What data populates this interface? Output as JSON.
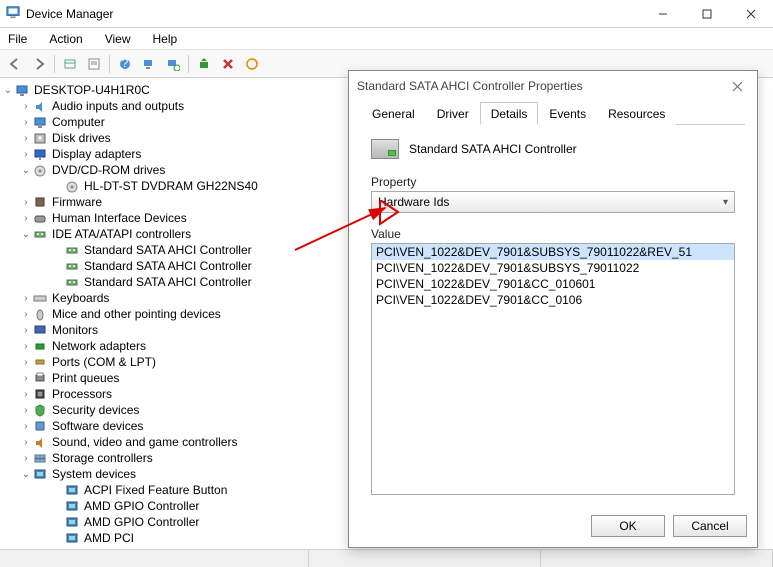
{
  "window": {
    "title": "Device Manager"
  },
  "menus": [
    "File",
    "Action",
    "View",
    "Help"
  ],
  "tree": {
    "root": "DESKTOP-U4H1R0C",
    "items": [
      {
        "label": "Audio inputs and outputs",
        "icon": "audio",
        "expander": "›"
      },
      {
        "label": "Computer",
        "icon": "computer",
        "expander": "›"
      },
      {
        "label": "Disk drives",
        "icon": "disk",
        "expander": "›"
      },
      {
        "label": "Display adapters",
        "icon": "display",
        "expander": "›"
      },
      {
        "label": "DVD/CD-ROM drives",
        "icon": "dvd",
        "expander": "⌄",
        "children": [
          {
            "label": "HL-DT-ST DVDRAM GH22NS40",
            "icon": "dvd"
          }
        ]
      },
      {
        "label": "Firmware",
        "icon": "firmware",
        "expander": "›"
      },
      {
        "label": "Human Interface Devices",
        "icon": "hid",
        "expander": "›"
      },
      {
        "label": "IDE ATA/ATAPI controllers",
        "icon": "ide",
        "expander": "⌄",
        "children": [
          {
            "label": "Standard SATA AHCI Controller",
            "icon": "ide"
          },
          {
            "label": "Standard SATA AHCI Controller",
            "icon": "ide"
          },
          {
            "label": "Standard SATA AHCI Controller",
            "icon": "ide"
          }
        ]
      },
      {
        "label": "Keyboards",
        "icon": "keyboard",
        "expander": "›"
      },
      {
        "label": "Mice and other pointing devices",
        "icon": "mouse",
        "expander": "›"
      },
      {
        "label": "Monitors",
        "icon": "monitor",
        "expander": "›"
      },
      {
        "label": "Network adapters",
        "icon": "net",
        "expander": "›"
      },
      {
        "label": "Ports (COM & LPT)",
        "icon": "port",
        "expander": "›"
      },
      {
        "label": "Print queues",
        "icon": "print",
        "expander": "›"
      },
      {
        "label": "Processors",
        "icon": "cpu",
        "expander": "›"
      },
      {
        "label": "Security devices",
        "icon": "sec",
        "expander": "›"
      },
      {
        "label": "Software devices",
        "icon": "soft",
        "expander": "›"
      },
      {
        "label": "Sound, video and game controllers",
        "icon": "sound",
        "expander": "›"
      },
      {
        "label": "Storage controllers",
        "icon": "storage",
        "expander": "›"
      },
      {
        "label": "System devices",
        "icon": "system",
        "expander": "⌄",
        "children": [
          {
            "label": "ACPI Fixed Feature Button",
            "icon": "system"
          },
          {
            "label": "AMD GPIO Controller",
            "icon": "system"
          },
          {
            "label": "AMD GPIO Controller",
            "icon": "system"
          },
          {
            "label": "AMD PCI",
            "icon": "system"
          }
        ]
      }
    ]
  },
  "dialog": {
    "title": "Standard SATA AHCI Controller Properties",
    "tabs": [
      "General",
      "Driver",
      "Details",
      "Events",
      "Resources"
    ],
    "active_tab": 2,
    "device_name": "Standard SATA AHCI Controller",
    "property_label": "Property",
    "property_value": "Hardware Ids",
    "value_label": "Value",
    "values": [
      "PCI\\VEN_1022&DEV_7901&SUBSYS_79011022&REV_51",
      "PCI\\VEN_1022&DEV_7901&SUBSYS_79011022",
      "PCI\\VEN_1022&DEV_7901&CC_010601",
      "PCI\\VEN_1022&DEV_7901&CC_0106"
    ],
    "ok": "OK",
    "cancel": "Cancel"
  }
}
